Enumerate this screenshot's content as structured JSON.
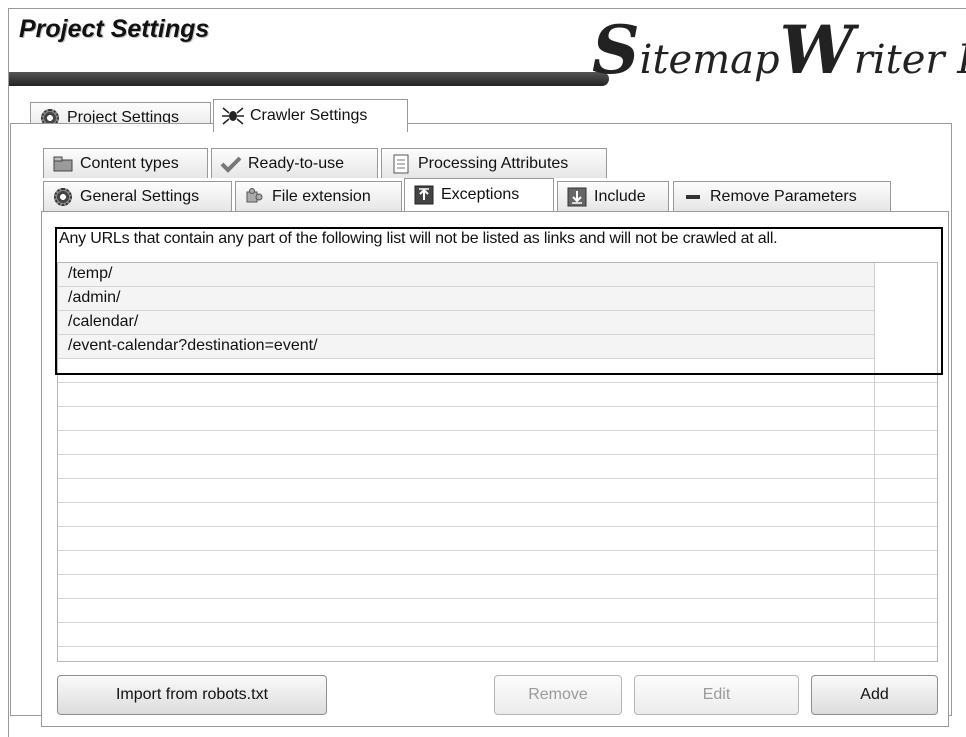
{
  "header": {
    "title": "Project Settings",
    "logo_text_a": "S",
    "logo_text_b": "itemap",
    "logo_text_c": "W",
    "logo_text_d": "riter Pro"
  },
  "top_tabs": [
    {
      "label": "Project Settings",
      "icon": "gear-icon",
      "active": false
    },
    {
      "label": "Crawler Settings",
      "icon": "spider-icon",
      "active": true
    }
  ],
  "sub_tabs_row1": [
    {
      "label": "Content types",
      "icon": "folder-icon"
    },
    {
      "label": "Ready-to-use",
      "icon": "checkmark-icon"
    },
    {
      "label": "Processing Attributes",
      "icon": "document-icon"
    }
  ],
  "sub_tabs_row2": [
    {
      "label": "General Settings",
      "icon": "gear-icon",
      "active": false
    },
    {
      "label": "File extension",
      "icon": "puzzle-icon",
      "active": false
    },
    {
      "label": "Exceptions",
      "icon": "upload-icon",
      "active": true
    },
    {
      "label": "Include",
      "icon": "download-icon",
      "active": false
    },
    {
      "label": "Remove Parameters",
      "icon": "minus-icon",
      "active": false
    }
  ],
  "exceptions": {
    "description": "Any URLs that contain any part of the following list will not be listed as links and will not be crawled at all.",
    "items": [
      "/temp/",
      "/admin/",
      "/calendar/",
      "/event-calendar?destination=event/"
    ]
  },
  "buttons": {
    "import": "Import from robots.txt",
    "remove": "Remove",
    "edit": "Edit",
    "add": "Add"
  }
}
